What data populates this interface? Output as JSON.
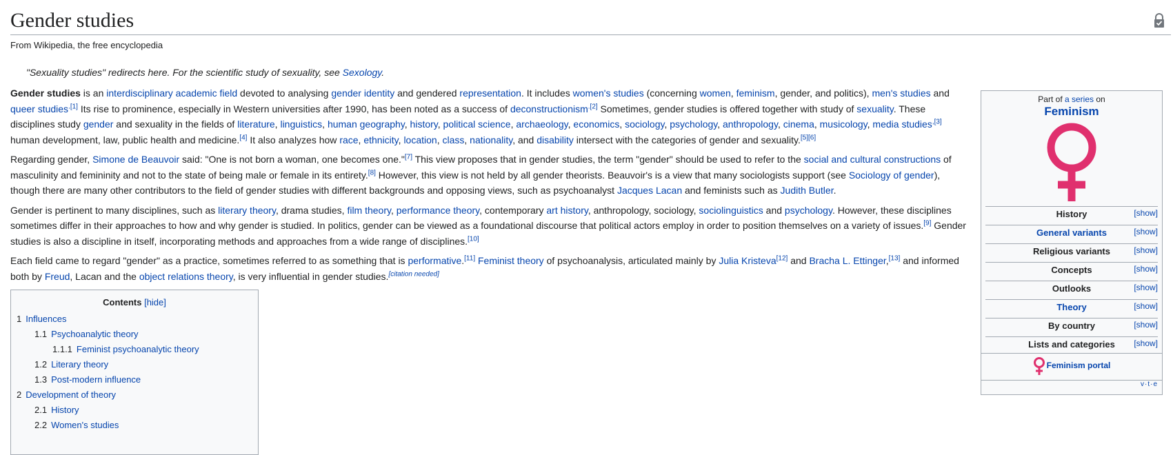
{
  "page": {
    "title": "Gender studies",
    "tagline": "From Wikipedia, the free encyclopedia",
    "hatnote": {
      "text": "\"Sexuality studies\" redirects here. For the scientific study of sexuality, see ",
      "link": "Sexology",
      "end": "."
    }
  },
  "article": {
    "p1": [
      {
        "t": "Gender studies",
        "b": true
      },
      {
        "t": " is an "
      },
      {
        "t": "interdisciplinary academic field",
        "l": true
      },
      {
        "t": " devoted to analysing "
      },
      {
        "t": "gender identity",
        "l": true
      },
      {
        "t": " and gendered "
      },
      {
        "t": "representation",
        "l": true
      },
      {
        "t": ". It includes "
      },
      {
        "t": "women's studies",
        "l": true
      },
      {
        "t": " (concerning "
      },
      {
        "t": "women",
        "l": true
      },
      {
        "t": ", "
      },
      {
        "t": "feminism",
        "l": true
      },
      {
        "t": ", gender, and politics), "
      },
      {
        "t": "men's studies",
        "l": true
      },
      {
        "t": " and "
      },
      {
        "t": "queer studies",
        "l": true
      },
      {
        "t": ".[1]",
        "s": true
      },
      {
        "t": " Its rise to prominence, especially in Western universities after 1990, has been noted as a success of "
      },
      {
        "t": "deconstructionism",
        "l": true
      },
      {
        "t": ".[2]",
        "s": true
      },
      {
        "t": " Sometimes, gender studies is offered together with study of "
      },
      {
        "t": "sexuality",
        "l": true
      },
      {
        "t": ". These disciplines study "
      },
      {
        "t": "gender",
        "l": true
      },
      {
        "t": " and sexuality in the fields of "
      },
      {
        "t": "literature",
        "l": true
      },
      {
        "t": ", "
      },
      {
        "t": "linguistics",
        "l": true
      },
      {
        "t": ", "
      },
      {
        "t": "human geography",
        "l": true
      },
      {
        "t": ", "
      },
      {
        "t": "history",
        "l": true
      },
      {
        "t": ", "
      },
      {
        "t": "political science",
        "l": true
      },
      {
        "t": ", "
      },
      {
        "t": "archaeology",
        "l": true
      },
      {
        "t": ", "
      },
      {
        "t": "economics",
        "l": true
      },
      {
        "t": ", "
      },
      {
        "t": "sociology",
        "l": true
      },
      {
        "t": ", "
      },
      {
        "t": "psychology",
        "l": true
      },
      {
        "t": ", "
      },
      {
        "t": "anthropology",
        "l": true
      },
      {
        "t": ", "
      },
      {
        "t": "cinema",
        "l": true
      },
      {
        "t": ", "
      },
      {
        "t": "musicology",
        "l": true
      },
      {
        "t": ", "
      },
      {
        "t": "media studies",
        "l": true
      },
      {
        "t": ",[3]",
        "s": true
      },
      {
        "t": " human development, law, public health and medicine."
      },
      {
        "t": "[4]",
        "s": true
      },
      {
        "t": " It also analyzes how "
      },
      {
        "t": "race",
        "l": true
      },
      {
        "t": ", "
      },
      {
        "t": "ethnicity",
        "l": true
      },
      {
        "t": ", "
      },
      {
        "t": "location",
        "l": true
      },
      {
        "t": ", "
      },
      {
        "t": "class",
        "l": true
      },
      {
        "t": ", "
      },
      {
        "t": "nationality",
        "l": true
      },
      {
        "t": ", and "
      },
      {
        "t": "disability",
        "l": true
      },
      {
        "t": " intersect with the categories of gender and sexuality."
      },
      {
        "t": "[5][6]",
        "s": true
      }
    ],
    "p2": [
      {
        "t": "Regarding gender, "
      },
      {
        "t": "Simone de Beauvoir",
        "l": true
      },
      {
        "t": " said: \"One is not born a woman, one becomes one.\""
      },
      {
        "t": "[7]",
        "s": true
      },
      {
        "t": " This view proposes that in gender studies, the term \"gender\" should be used to refer to the "
      },
      {
        "t": "social and cultural constructions",
        "l": true
      },
      {
        "t": " of masculinity and femininity and not to the state of being male or female in its entirety."
      },
      {
        "t": "[8]",
        "s": true
      },
      {
        "t": " However, this view is not held by all gender theorists. Beauvoir's is a view that many sociologists support (see "
      },
      {
        "t": "Sociology of gender",
        "l": true
      },
      {
        "t": "), though there are many other contributors to the field of gender studies with different backgrounds and opposing views, such as psychoanalyst "
      },
      {
        "t": "Jacques Lacan",
        "l": true
      },
      {
        "t": " and feminists such as "
      },
      {
        "t": "Judith Butler",
        "l": true
      },
      {
        "t": "."
      }
    ],
    "p3": [
      {
        "t": "Gender is pertinent to many disciplines, such as "
      },
      {
        "t": "literary theory",
        "l": true
      },
      {
        "t": ", drama studies, "
      },
      {
        "t": "film theory",
        "l": true
      },
      {
        "t": ", "
      },
      {
        "t": "performance theory",
        "l": true
      },
      {
        "t": ", contemporary "
      },
      {
        "t": "art history",
        "l": true
      },
      {
        "t": ", anthropology, sociology, "
      },
      {
        "t": "sociolinguistics",
        "l": true
      },
      {
        "t": " and "
      },
      {
        "t": "psychology",
        "l": true
      },
      {
        "t": ". However, these disciplines sometimes differ in their approaches to how and why gender is studied. In politics, gender can be viewed as a foundational discourse that political actors employ in order to position themselves on a variety of issues."
      },
      {
        "t": "[9]",
        "s": true
      },
      {
        "t": " Gender studies is also a discipline in itself, incorporating methods and approaches from a wide range of disciplines."
      },
      {
        "t": "[10]",
        "s": true
      }
    ],
    "p4": [
      {
        "t": "Each field came to regard \"gender\" as a practice, sometimes referred to as something that is "
      },
      {
        "t": "performative",
        "l": true
      },
      {
        "t": "."
      },
      {
        "t": "[11]",
        "s": true
      },
      {
        "t": " "
      },
      {
        "t": "Feminist theory",
        "l": true
      },
      {
        "t": " of psychoanalysis, articulated mainly by "
      },
      {
        "t": "Julia Kristeva",
        "l": true
      },
      {
        "t": "[12]",
        "s": true
      },
      {
        "t": " and "
      },
      {
        "t": "Bracha L. Ettinger",
        "l": true
      },
      {
        "t": ",",
        "l": false
      },
      {
        "t": "[13]",
        "s": true
      },
      {
        "t": " and informed both by "
      },
      {
        "t": "Freud",
        "l": true
      },
      {
        "t": ", Lacan and the "
      },
      {
        "t": "object relations theory",
        "l": true
      },
      {
        "t": ", is very influential in gender studies."
      },
      {
        "t": "[citation needed]",
        "s": true,
        "cn": true
      }
    ]
  },
  "toc": {
    "title": "Contents",
    "hide_label": "[hide]",
    "items": [
      {
        "num": "1",
        "label": "Influences",
        "level": 1
      },
      {
        "num": "1.1",
        "label": "Psychoanalytic theory",
        "level": 2
      },
      {
        "num": "1.1.1",
        "label": "Feminist psychoanalytic theory",
        "level": 3
      },
      {
        "num": "1.2",
        "label": "Literary theory",
        "level": 2
      },
      {
        "num": "1.3",
        "label": "Post-modern influence",
        "level": 2
      },
      {
        "num": "2",
        "label": "Development of theory",
        "level": 1
      },
      {
        "num": "2.1",
        "label": "History",
        "level": 2
      },
      {
        "num": "2.2",
        "label": "Women's studies",
        "level": 2
      }
    ]
  },
  "sidebar": {
    "above_prefix": "Part of ",
    "above_link": "a series",
    "above_suffix": " on",
    "title": "Feminism",
    "symbol_color": "#e0306e",
    "show_label": "[show]",
    "rows": [
      {
        "label": "History",
        "link": false
      },
      {
        "label": "General variants",
        "link": true
      },
      {
        "label": "Religious variants",
        "link": false
      },
      {
        "label": "Concepts",
        "link": false
      },
      {
        "label": "Outlooks",
        "link": false
      },
      {
        "label": "Theory",
        "link": true
      },
      {
        "label": "By country",
        "link": false
      },
      {
        "label": "Lists and categories",
        "link": false
      }
    ],
    "portal_label": "Feminism portal",
    "vte": "v·t·e"
  }
}
